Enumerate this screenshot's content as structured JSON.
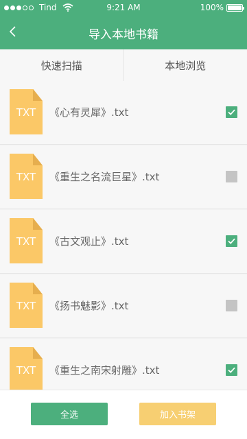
{
  "status_bar": {
    "carrier": "Tind",
    "time": "9:21 AM",
    "battery": "100%"
  },
  "header": {
    "title": "导入本地书籍"
  },
  "tabs": [
    {
      "label": "快速扫描"
    },
    {
      "label": "本地浏览"
    }
  ],
  "files": [
    {
      "icon_label": "TXT",
      "name": "《心有灵犀》.txt",
      "checked": true
    },
    {
      "icon_label": "TXT",
      "name": "《重生之名流巨星》.txt",
      "checked": false
    },
    {
      "icon_label": "TXT",
      "name": "《古文观止》.txt",
      "checked": true
    },
    {
      "icon_label": "TXT",
      "name": "《扬书魅影》.txt",
      "checked": false
    },
    {
      "icon_label": "TXT",
      "name": "《重生之南宋射雕》.txt",
      "checked": true
    }
  ],
  "bottom_bar": {
    "select_all_label": "全选",
    "add_to_shelf_label": "加入书架"
  },
  "colors": {
    "accent": "#4caf7d",
    "txt_icon": "#fbc867",
    "add_button": "#f7cf72",
    "unchecked": "#c4c4c4"
  }
}
